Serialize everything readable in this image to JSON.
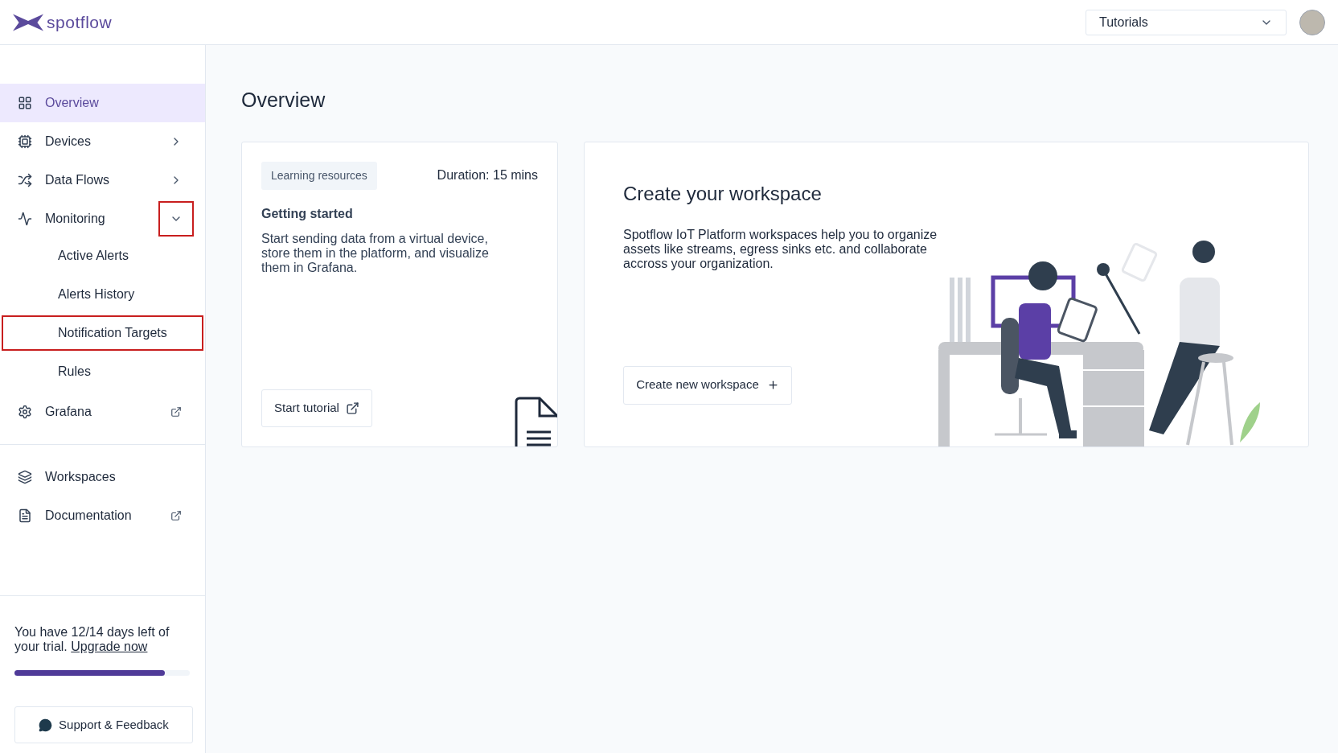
{
  "header": {
    "logo": "spotflow",
    "selector": {
      "value": "Tutorials"
    }
  },
  "sidebar": {
    "items": [
      {
        "label": "Overview",
        "kind": "grid",
        "selected": true,
        "expandable": false,
        "external": false
      },
      {
        "label": "Devices",
        "kind": "device",
        "selected": false,
        "expandable": true,
        "expanded": false,
        "highlighted": false,
        "external": false
      },
      {
        "label": "Data Flows",
        "kind": "shuffle",
        "selected": false,
        "expandable": true,
        "expanded": false,
        "highlighted": false,
        "external": false
      },
      {
        "label": "Monitoring",
        "kind": "pulse",
        "selected": false,
        "expandable": true,
        "expanded": true,
        "highlighted": true,
        "external": false,
        "children": [
          {
            "label": "Active Alerts",
            "selected": false,
            "highlighted": false
          },
          {
            "label": "Alerts History",
            "selected": false,
            "highlighted": false
          },
          {
            "label": "Notification Targets",
            "selected": false,
            "highlighted": true
          },
          {
            "label": "Rules",
            "selected": false,
            "highlighted": false
          }
        ]
      },
      {
        "label": "Grafana",
        "kind": "gear",
        "selected": false,
        "expandable": false,
        "external": true
      }
    ],
    "secondary_items": [
      {
        "label": "Workspaces",
        "kind": "layers",
        "selected": false,
        "expandable": false,
        "external": false
      },
      {
        "label": "Documentation",
        "kind": "file",
        "selected": false,
        "expandable": false,
        "external": true
      }
    ],
    "trial": {
      "text": "You have 12/14 days left of your trial.",
      "link": "Upgrade now",
      "level": 0.86
    },
    "support_button": "Support & Feedback"
  },
  "main": {
    "title": "Overview",
    "tutorial_card": {
      "tag": "Learning resources",
      "duration": "Duration: 15 mins",
      "title": "Getting started",
      "description": "Start sending data from a virtual device, store them in the platform, and visualize them in Grafana.",
      "button": "Start tutorial"
    },
    "workspace_card": {
      "title": "Create your workspace",
      "description": "Spotflow IoT Platform workspaces help you to organize assets like streams, egress sinks etc. and collaborate accross your organization.",
      "button": "Create new workspace"
    }
  }
}
